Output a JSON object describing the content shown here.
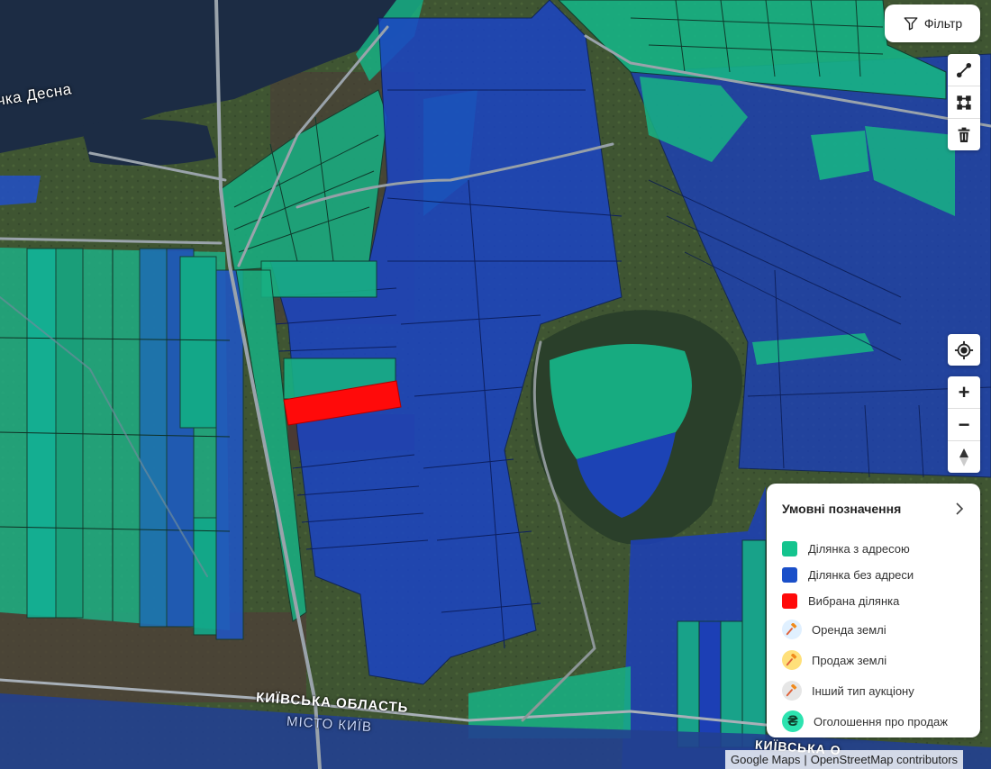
{
  "map": {
    "river_label": "ічка Десна",
    "region_label": "КИЇВСЬКА ОБЛАСТЬ",
    "city_label": "МІСТО КИЇВ",
    "region_label_2": "КИЇВСЬКА О"
  },
  "controls": {
    "filter_label": "Фільтр",
    "draw_tools": [
      "draw-line-icon",
      "draw-polygon-icon",
      "trash-icon"
    ],
    "locate": "crosshair-icon",
    "zoom_in": "+",
    "zoom_out": "−",
    "compass": "compass-icon"
  },
  "legend": {
    "title": "Умовні позначення",
    "items": [
      {
        "label": "Ділянка з адресою",
        "color": "#14c48e"
      },
      {
        "label": "Ділянка без адреси",
        "color": "#1a4fc9"
      },
      {
        "label": "Вибрана ділянка",
        "color": "#ff0a0a"
      },
      {
        "label": "Оренда землі",
        "icon": "auction-hammer-icon",
        "color": "#e0f0ff"
      },
      {
        "label": "Продаж землі",
        "icon": "auction-hammer-icon",
        "color": "#ffe07a"
      },
      {
        "label": "Інший тип аукціону",
        "icon": "auction-hammer-icon",
        "color": "#e6e6e6"
      },
      {
        "label": "Оголошення про продаж",
        "icon": "hryvnia-icon",
        "color": "#2de3b0"
      }
    ]
  },
  "attribution": {
    "google": "Google Maps",
    "separator": "|",
    "osm": "OpenStreetMap contributors"
  }
}
